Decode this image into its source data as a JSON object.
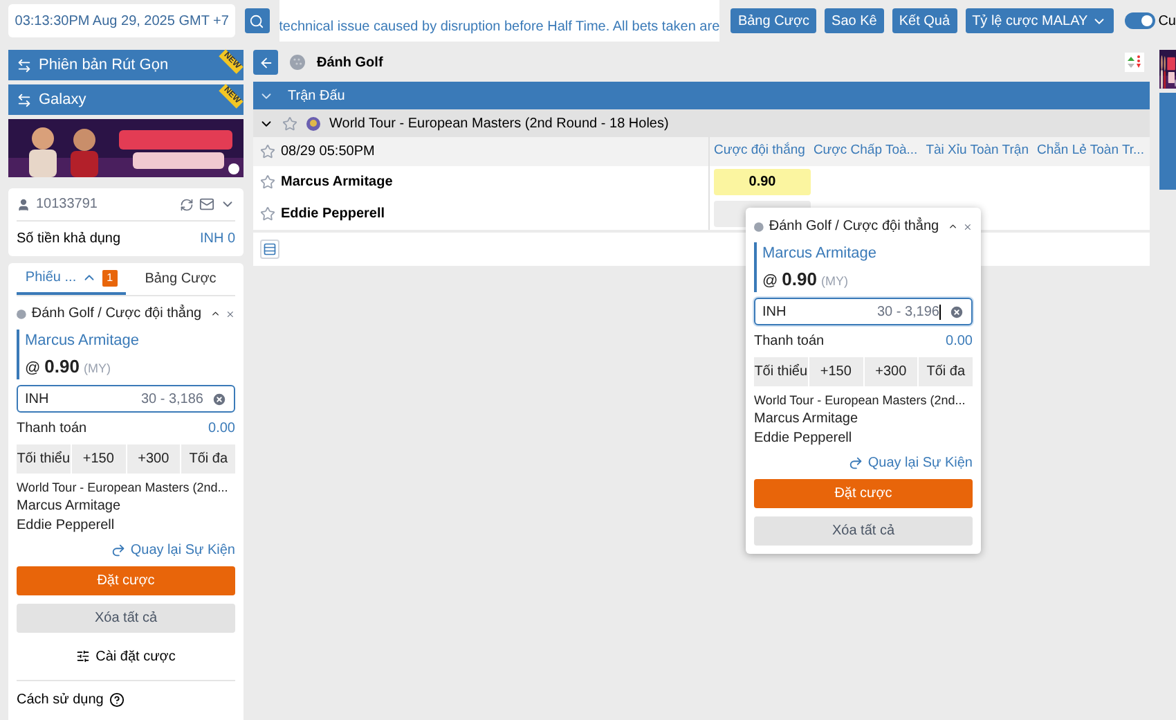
{
  "header": {
    "clock": "03:13:30PM Aug 29, 2025 GMT +7",
    "ticker": "technical issue caused by disruption before Half Time. All bets taken are",
    "buttons": [
      "Bảng Cược",
      "Sao Kê",
      "Kết Quả"
    ],
    "odds_menu": "Tỷ lệ cược MALAY",
    "toggle": {
      "on": true,
      "label": "Cu"
    }
  },
  "sidebar": {
    "versions": [
      {
        "label": "Phiên bản Rút Gọn",
        "badge": "NEW"
      },
      {
        "label": "Galaxy",
        "badge": "NEW"
      }
    ],
    "account": {
      "id": "10133791",
      "balance_label": "Số tiền khả dụng",
      "balance": "INH 0"
    },
    "bet_slip": {
      "tabs": [
        {
          "label": "Phiếu ...",
          "selected": true,
          "count": "1"
        },
        {
          "label": "Bảng Cược",
          "selected": false
        }
      ],
      "ticket": {
        "market": "Đánh Golf / Cược đội thẳng",
        "selection": "Marcus Armitage",
        "at": "@",
        "odds": "0.90",
        "odds_type": "(MY)",
        "currency": "INH",
        "stake_range": "30 - 3,186",
        "focused": false,
        "payout_label": "Thanh toán",
        "payout": "0.00",
        "quick_stakes": [
          "Tối thiểu",
          "+150",
          "+300",
          "Tối đa"
        ],
        "event": "World Tour - European Masters (2nd...",
        "home": "Marcus Armitage",
        "away": "Eddie Pepperell",
        "back_link": "Quay lại Sự Kiện",
        "place_bet": "Đặt cược",
        "clear_all": "Xóa tất cả"
      },
      "settings": "Cài đặt cược"
    },
    "help": "Cách sử dụng"
  },
  "main": {
    "sport": "Đánh Golf",
    "section": "Trận Đấu",
    "league": "World Tour - European Masters (2nd Round - 18 Holes)",
    "match": {
      "time": "08/29 05:50PM",
      "columns": [
        "Cược đội thắng",
        "Cược Chấp Toà...",
        "Tài Xỉu Toàn Trận",
        "Chẵn Lẻ Toàn Tr..."
      ],
      "teams": [
        {
          "name": "Marcus Armitage",
          "odds": "0.90",
          "selected": true
        },
        {
          "name": "Eddie Pepperell",
          "selected": false
        }
      ]
    }
  },
  "popup": {
    "market": "Đánh Golf / Cược đội thẳng",
    "selection": "Marcus Armitage",
    "at": "@",
    "odds": "0.90",
    "odds_type": "(MY)",
    "currency": "INH",
    "stake_range": "30 - 3,196",
    "focused": true,
    "payout_label": "Thanh toán",
    "payout": "0.00",
    "quick_stakes": [
      "Tối thiểu",
      "+150",
      "+300",
      "Tối đa"
    ],
    "event": "World Tour - European Masters (2nd...",
    "home": "Marcus Armitage",
    "away": "Eddie Pepperell",
    "back_link": "Quay lại Sự Kiện",
    "place_bet": "Đặt cược",
    "clear_all": "Xóa tất cả"
  }
}
